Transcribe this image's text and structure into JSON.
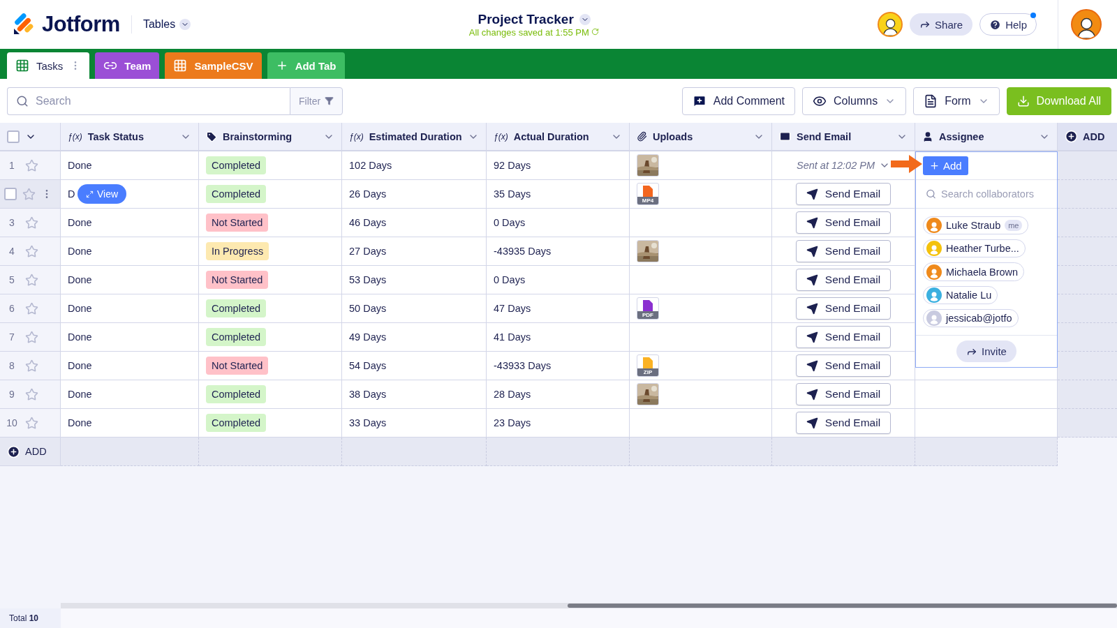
{
  "header": {
    "brand": "Jotform",
    "product": "Tables",
    "title": "Project Tracker",
    "saved": "All changes saved at 1:55 PM",
    "share": "Share",
    "help": "Help",
    "help_notification": true
  },
  "tabs": [
    {
      "label": "Tasks",
      "kind": "grid",
      "selected": true,
      "color": "#ffffff"
    },
    {
      "label": "Team",
      "kind": "link",
      "selected": false,
      "color": "#9b4fd6"
    },
    {
      "label": "SampleCSV",
      "kind": "grid",
      "selected": false,
      "color": "#ec7a1c"
    },
    {
      "label": "Add Tab",
      "kind": "add",
      "selected": false,
      "color": "#3dbd63"
    }
  ],
  "toolbar": {
    "search": {
      "placeholder": "Search"
    },
    "filter": "Filter",
    "buttons": [
      {
        "label": "Add Comment",
        "kind": "comment"
      },
      {
        "label": "Columns",
        "kind": "eye"
      },
      {
        "label": "Form",
        "kind": "form"
      },
      {
        "label": "Download All",
        "kind": "download"
      }
    ]
  },
  "table": {
    "all_selected": false,
    "columns": [
      {
        "label": "Task Status",
        "kind": "formula",
        "symbol": "ƒ(x)"
      },
      {
        "label": "Brainstorming",
        "kind": "tag"
      },
      {
        "label": "Estimated Duration",
        "kind": "formula",
        "symbol": "ƒ(x)"
      },
      {
        "label": "Actual Duration",
        "kind": "formula",
        "symbol": "ƒ(x)"
      },
      {
        "label": "Uploads",
        "kind": "clip"
      },
      {
        "label": "Send Email",
        "kind": "mail"
      },
      {
        "label": "Assignee",
        "kind": "person"
      }
    ],
    "add_column": "ADD",
    "rows": [
      {
        "number": "1",
        "hovered": false,
        "starred": false,
        "status": "Done",
        "brainstorming": {
          "label": "Completed",
          "color": "#d4f5c9"
        },
        "estimated": "102 Days",
        "actual": "92 Days",
        "email": {
          "kind": "sent",
          "label": "Sent at 12:02 PM"
        }
      },
      {
        "hovered": true,
        "checked": false,
        "starred": false,
        "status": "D",
        "view": "View",
        "brainstorming": {
          "label": "Completed",
          "color": "#d4f5c9"
        },
        "estimated": "26 Days",
        "actual": "35 Days",
        "upload": {
          "kind": "file",
          "label": "MP4",
          "color": "#f3661f"
        },
        "email": {
          "kind": "button",
          "label": "Send Email"
        }
      },
      {
        "number": "3",
        "hovered": false,
        "starred": false,
        "status": "Done",
        "brainstorming": {
          "label": "Not Started",
          "color": "#ffc1c8"
        },
        "estimated": "46 Days",
        "actual": "0 Days",
        "email": {
          "kind": "button",
          "label": "Send Email"
        }
      },
      {
        "number": "4",
        "hovered": false,
        "starred": false,
        "status": "Done",
        "brainstorming": {
          "label": "In Progress",
          "color": "#fde9b0"
        },
        "estimated": "27 Days",
        "actual": "-43935 Days",
        "email": {
          "kind": "button",
          "label": "Send Email"
        }
      },
      {
        "number": "5",
        "hovered": false,
        "starred": false,
        "status": "Done",
        "brainstorming": {
          "label": "Not Started",
          "color": "#ffc1c8"
        },
        "estimated": "53 Days",
        "actual": "0 Days",
        "email": {
          "kind": "button",
          "label": "Send Email"
        }
      },
      {
        "number": "6",
        "hovered": false,
        "starred": false,
        "status": "Done",
        "brainstorming": {
          "label": "Completed",
          "color": "#d4f5c9"
        },
        "estimated": "50 Days",
        "actual": "47 Days",
        "upload": {
          "kind": "file",
          "label": "PDF",
          "color": "#8b2fd0"
        },
        "email": {
          "kind": "button",
          "label": "Send Email"
        }
      },
      {
        "number": "7",
        "hovered": false,
        "starred": false,
        "status": "Done",
        "brainstorming": {
          "label": "Completed",
          "color": "#d4f5c9"
        },
        "estimated": "49 Days",
        "actual": "41 Days",
        "email": {
          "kind": "button",
          "label": "Send Email"
        }
      },
      {
        "number": "8",
        "hovered": false,
        "starred": false,
        "status": "Done",
        "brainstorming": {
          "label": "Not Started",
          "color": "#ffc1c8"
        },
        "estimated": "54 Days",
        "actual": "-43933 Days",
        "upload": {
          "kind": "file",
          "label": "ZIP",
          "color": "#fbb224"
        },
        "email": {
          "kind": "button",
          "label": "Send Email"
        }
      },
      {
        "number": "9",
        "hovered": false,
        "starred": false,
        "status": "Done",
        "brainstorming": {
          "label": "Completed",
          "color": "#d4f5c9"
        },
        "estimated": "38 Days",
        "actual": "28 Days",
        "email": {
          "kind": "button",
          "label": "Send Email"
        }
      },
      {
        "number": "10",
        "hovered": false,
        "starred": false,
        "status": "Done",
        "brainstorming": {
          "label": "Completed",
          "color": "#d4f5c9"
        },
        "estimated": "33 Days",
        "actual": "23 Days",
        "email": {
          "kind": "button",
          "label": "Send Email"
        }
      }
    ],
    "add_row": "ADD",
    "total": "Total **10**"
  },
  "assignee_popup": {
    "add": "Add",
    "search_placeholder": "Search collaborators",
    "collaborators": [
      {
        "name": "Luke Straub",
        "tag": "me",
        "color": "#ef8a1c"
      },
      {
        "name": "Heather Turbe...",
        "color": "#f4c20d"
      },
      {
        "name": "Michaela Brown",
        "color": "#ef8a1c"
      },
      {
        "name": "Natalie Lu",
        "color": "#3bb0e0"
      },
      {
        "name": "jessicab@jotfo",
        "color": "#c9cbe0"
      }
    ],
    "invite": "Invite"
  }
}
